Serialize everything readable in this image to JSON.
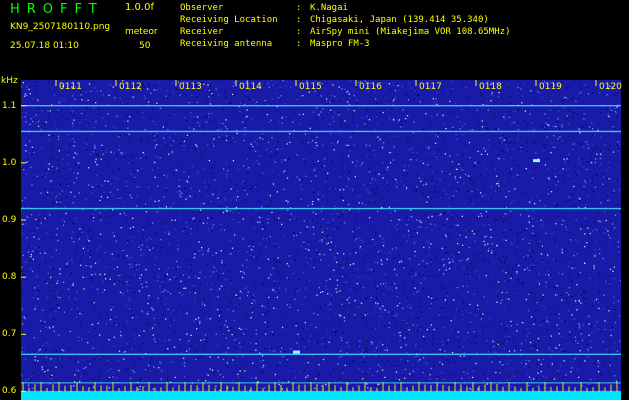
{
  "header": {
    "app_title": "HROFFT",
    "version": "1.0.0f",
    "file_name": "KN9_2507180110.png",
    "mode": "meteor",
    "datetime": "25.07.18 01:10",
    "count": "50",
    "fields": [
      {
        "key": "Observer",
        "sep": ":",
        "value": "K.Nagai"
      },
      {
        "key": "Receiving Location",
        "sep": ":",
        "value": "Chigasaki, Japan (139.414 35.340)"
      },
      {
        "key": "Receiver",
        "sep": ":",
        "value": "AirSpy mini (Miakejima VOR 108.65MHz)"
      },
      {
        "key": "Receiving antenna",
        "sep": ":",
        "value": "Maspro FM-3"
      }
    ]
  },
  "colors": {
    "background": "#000000",
    "text_yellow": "#ffff00",
    "title_green": "#00ff00",
    "spectrum_blue": "#1a1aa8",
    "signal_cyan": "#40e0ff",
    "baseline_cyan": "#00e5ff"
  },
  "chart_data": {
    "type": "heatmap",
    "ylabel": "kHz",
    "y_ticks": [
      "1.1",
      "1.0",
      "0.9",
      "0.8",
      "0.7",
      "0.6"
    ],
    "y_tick_values": [
      1.1,
      1.0,
      0.9,
      0.8,
      0.7,
      0.6
    ],
    "ylim": [
      0.585,
      1.145
    ],
    "x_ticks": [
      "0111",
      "0112",
      "0113",
      "0114",
      "0115",
      "0116",
      "0117",
      "0118",
      "0119",
      "0120"
    ],
    "carrier_lines_khz": [
      1.1,
      1.055,
      0.92,
      0.665,
      0.615,
      0.6
    ],
    "meteor_events": [
      {
        "time": "0119",
        "freq_khz": 1.003
      },
      {
        "time": "0115",
        "freq_khz": 0.668
      }
    ],
    "grid": false
  }
}
